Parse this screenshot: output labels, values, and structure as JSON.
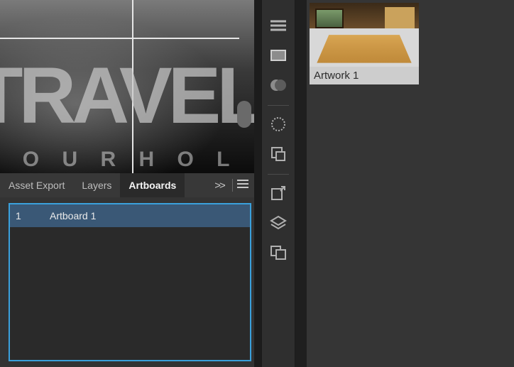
{
  "canvas": {
    "headline": "TRAVEL",
    "subline": "Y O U R   H O L I D A"
  },
  "panel": {
    "tabs": [
      "Asset Export",
      "Layers",
      "Artboards"
    ],
    "active_tab_index": 2,
    "expand_glyph": ">>"
  },
  "artboards": {
    "items": [
      {
        "index": "1",
        "name": "Artboard 1"
      }
    ]
  },
  "thumbnail": {
    "label": "Artwork 1"
  },
  "tool_column": {
    "icons": [
      "menu-icon",
      "fill-rect-icon",
      "blend-icon",
      "separator",
      "radial-icon",
      "resize-icon",
      "separator",
      "export-icon",
      "layers-icon",
      "artboards-icon"
    ]
  },
  "highlight_color": "#1fd51f"
}
